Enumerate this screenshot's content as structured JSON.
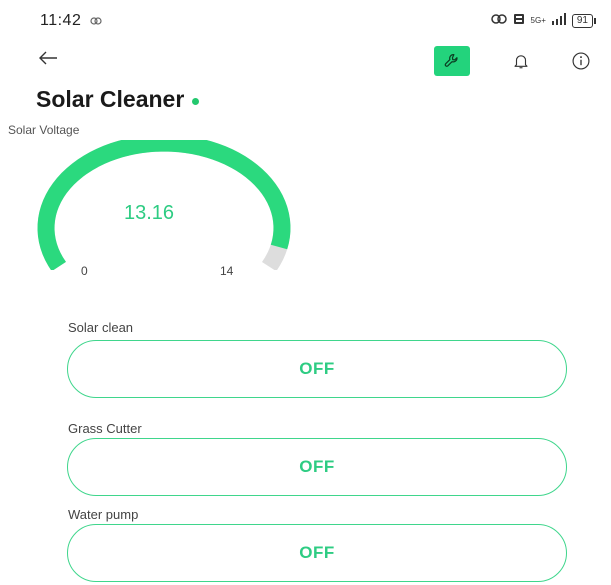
{
  "status_bar": {
    "time": "11:42",
    "network_label": "5G+",
    "battery": "91"
  },
  "header": {
    "title": "Solar Cleaner"
  },
  "gauge": {
    "label": "Solar Voltage",
    "value": "13.16",
    "value_numeric": 13.16,
    "min": "0",
    "max": "14",
    "min_numeric": 0,
    "max_numeric": 14
  },
  "switches": [
    {
      "label": "Solar clean",
      "state": "OFF"
    },
    {
      "label": "Grass Cutter",
      "state": "OFF"
    },
    {
      "label": "Water pump",
      "state": "OFF"
    }
  ],
  "colors": {
    "accent": "#23d37c",
    "gauge_fill": "#2bd97e",
    "gauge_track": "#dddddd",
    "text_green": "#2ecc83",
    "online": "#23c86e"
  },
  "icons": {
    "back": "arrow-left-icon",
    "settings": "wrench-icon",
    "notifications": "bell-icon",
    "info": "info-icon"
  }
}
